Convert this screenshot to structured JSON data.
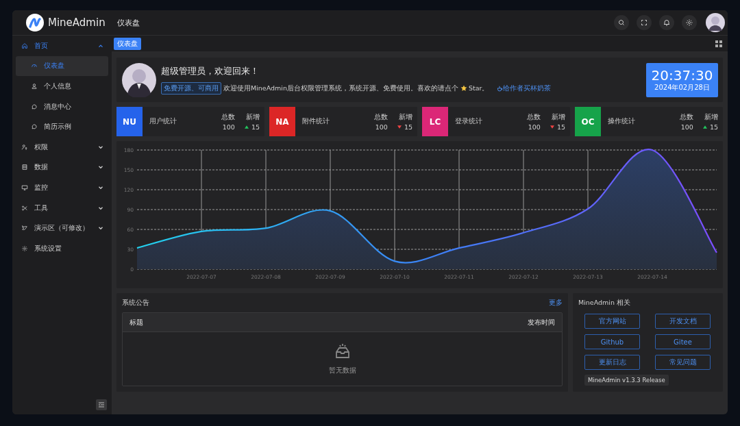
{
  "header": {
    "brand": "MineAdmin",
    "breadcrumb": "仪表盘"
  },
  "sidebar": {
    "items": [
      {
        "label": "首页",
        "expanded": true,
        "active": true,
        "children": [
          {
            "label": "仪表盘",
            "selected": true
          },
          {
            "label": "个人信息",
            "selected": false
          },
          {
            "label": "消息中心",
            "selected": false
          },
          {
            "label": "简历示例",
            "selected": false
          }
        ]
      },
      {
        "label": "权限",
        "expanded": false,
        "active": false
      },
      {
        "label": "数据",
        "expanded": false,
        "active": false
      },
      {
        "label": "监控",
        "expanded": false,
        "active": false
      },
      {
        "label": "工具",
        "expanded": false,
        "active": false
      },
      {
        "label": "演示区（可修改）",
        "expanded": false,
        "active": false
      },
      {
        "label": "系统设置",
        "active": false
      }
    ]
  },
  "tabs": [
    {
      "label": "仪表盘",
      "selected": true
    }
  ],
  "welcome": {
    "title": "超级管理员，欢迎回来！",
    "tag": "免费开源、可商用",
    "text": "欢迎使用MineAdmin后台权限管理系统，系统开源、免费使用。喜欢的请点个",
    "star_text": "Star。",
    "link": "给作者买杯奶茶",
    "time": "20:37:30",
    "date": "2024年02月28日"
  },
  "stats": [
    {
      "code": "NU",
      "color": "#2563eb",
      "label": "用户统计",
      "total_label": "总数",
      "total": "100",
      "new_label": "新增",
      "rising": true,
      "new": "15"
    },
    {
      "code": "NA",
      "color": "#dc2626",
      "label": "附件统计",
      "total_label": "总数",
      "total": "100",
      "new_label": "新增",
      "rising": false,
      "new": "15"
    },
    {
      "code": "LC",
      "color": "#db2777",
      "label": "登录统计",
      "total_label": "总数",
      "total": "100",
      "new_label": "新增",
      "rising": false,
      "new": "15"
    },
    {
      "code": "OC",
      "color": "#16a34a",
      "label": "操作统计",
      "total_label": "总数",
      "total": "100",
      "new_label": "新增",
      "rising": true,
      "new": "15"
    }
  ],
  "chart": {
    "chart_data": {
      "type": "area",
      "categories": [
        null,
        "2022-07-07",
        "2022-07-08",
        "2022-07-09",
        "2022-07-10",
        "2022-07-11",
        "2022-07-12",
        "2022-07-13",
        "2022-07-14",
        null
      ],
      "series": [
        {
          "color": "#3b82f6",
          "values": [
            32,
            57,
            62,
            88,
            12,
            32,
            55,
            91,
            180,
            25
          ]
        }
      ],
      "ylim": [
        0,
        180
      ],
      "grid": true,
      "yticks": [
        0,
        30,
        60,
        90,
        120,
        150,
        180
      ]
    }
  },
  "notice": {
    "title": "系统公告",
    "more": "更多",
    "columns": [
      "标题",
      "发布时间"
    ],
    "empty": "暂无数据"
  },
  "related": {
    "title": "MineAdmin 相关",
    "buttons": [
      "官方网站",
      "开发文档",
      "Github",
      "Gitee",
      "更新日志",
      "常见问题"
    ],
    "version": "MineAdmin v1.3.3 Release"
  }
}
